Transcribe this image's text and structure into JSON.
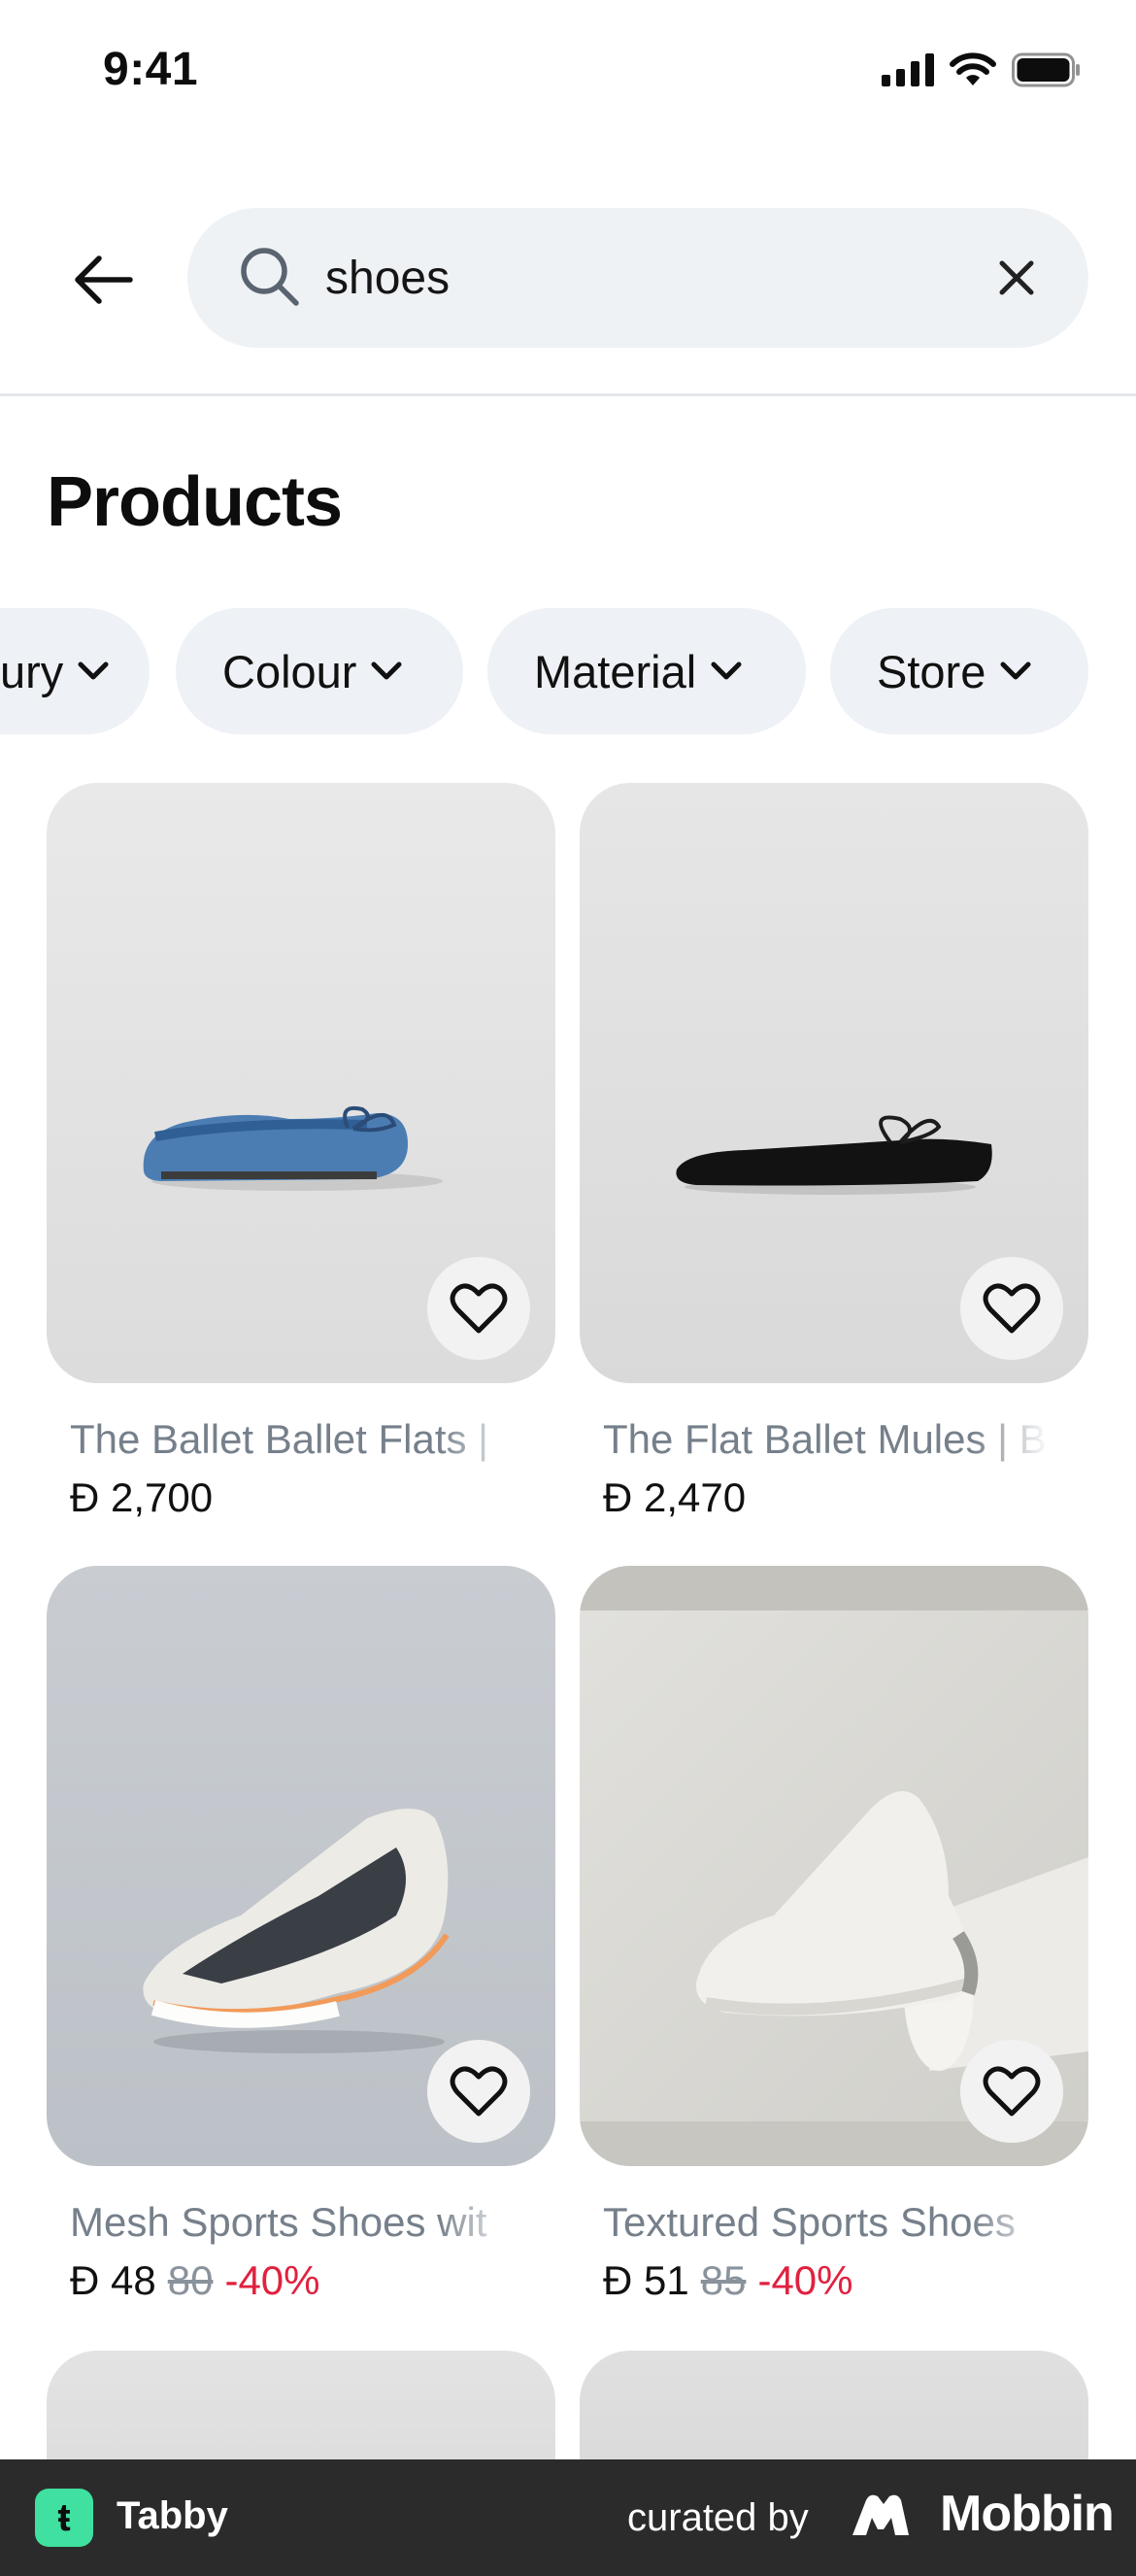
{
  "status_bar": {
    "time": "9:41"
  },
  "search": {
    "value": "shoes",
    "placeholder": ""
  },
  "section": {
    "title": "Products"
  },
  "filters": [
    {
      "label": "ury"
    },
    {
      "label": "Colour"
    },
    {
      "label": "Material"
    },
    {
      "label": "Store"
    }
  ],
  "products": [
    {
      "title": "The Ballet Ballet Flats |",
      "currency": "Đ",
      "price": "2,700",
      "old_price": "",
      "discount": ""
    },
    {
      "title": "The Flat Ballet Mules | B",
      "currency": "Đ",
      "price": "2,470",
      "old_price": "",
      "discount": ""
    },
    {
      "title": "Mesh Sports Shoes wit",
      "currency": "Đ",
      "price": "48",
      "old_price": "80",
      "discount": "-40%"
    },
    {
      "title": "Textured Sports Shoes",
      "currency": "Đ",
      "price": "51",
      "old_price": "85",
      "discount": "-40%"
    }
  ],
  "bottom_bar": {
    "app_name": "Tabby",
    "app_logo_letter": "ŧ",
    "curated_by": "curated by",
    "brand": "Mobbin"
  },
  "colors": {
    "accent_discount": "#e0213f",
    "chip_background": "#eef1f5",
    "search_background": "#eff2f5",
    "banner_background": "#2b2b2b",
    "tabby_green": "#3fe0a0"
  }
}
